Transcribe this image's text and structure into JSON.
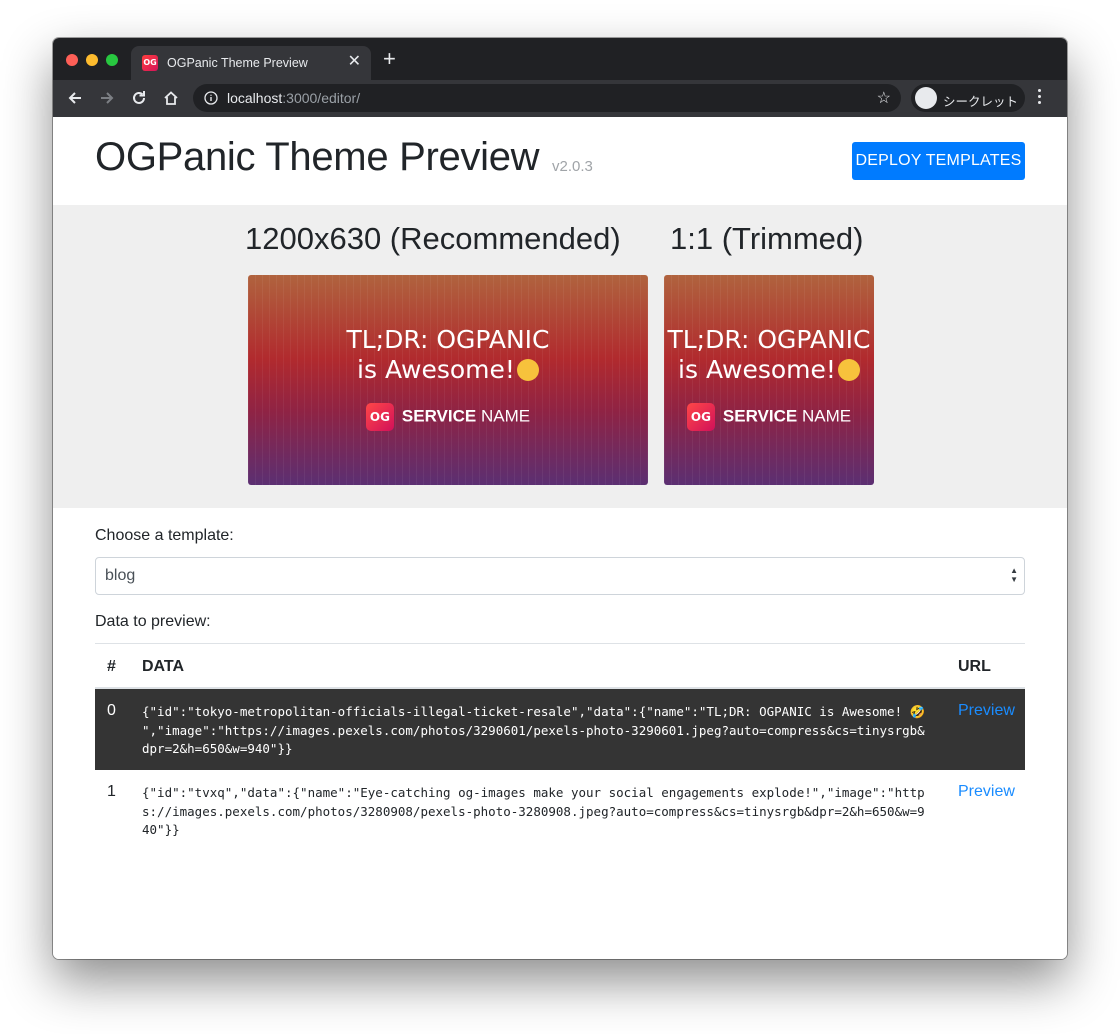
{
  "browser": {
    "tab_title": "OGPanic Theme Preview",
    "favicon_text": "OG",
    "url_host": "localhost",
    "url_rest": ":3000/editor/",
    "incognito_label": "シークレット"
  },
  "header": {
    "title": "OGPanic Theme Preview",
    "version": "v2.0.3",
    "deploy_label": "DEPLOY TEMPLATES"
  },
  "preview": {
    "heading_recommended": "1200x630 (Recommended)",
    "heading_trimmed": "1:1 (Trimmed)",
    "og_line1": "TL;DR: OGPANIC",
    "og_line2": "is Awesome!",
    "og_logo": "OG",
    "og_service_bold": "SERVICE",
    "og_service_rest": "NAME"
  },
  "form": {
    "choose_label": "Choose a template:",
    "template_value": "blog",
    "data_label": "Data to preview:"
  },
  "table": {
    "headers": {
      "num": "#",
      "data": "DATA",
      "url": "URL"
    },
    "rows": [
      {
        "num": "0",
        "data": "{\"id\":\"tokyo-metropolitan-officials-illegal-ticket-resale\",\"data\":{\"name\":\"TL;DR: OGPANIC is Awesome! 🤣 \",\"image\":\"https://images.pexels.com/photos/3290601/pexels-photo-3290601.jpeg?auto=compress&cs=tinysrgb&dpr=2&h=650&w=940\"}}",
        "link": "Preview"
      },
      {
        "num": "1",
        "data": "{\"id\":\"tvxq\",\"data\":{\"name\":\"Eye-catching og-images make your social engagements explode!\",\"image\":\"https://images.pexels.com/photos/3280908/pexels-photo-3280908.jpeg?auto=compress&cs=tinysrgb&dpr=2&h=650&w=940\"}}",
        "link": "Preview"
      }
    ]
  },
  "colors": {
    "primary": "#007bff",
    "link": "#1a8cff",
    "active_row": "#343434",
    "band": "#efefef"
  }
}
